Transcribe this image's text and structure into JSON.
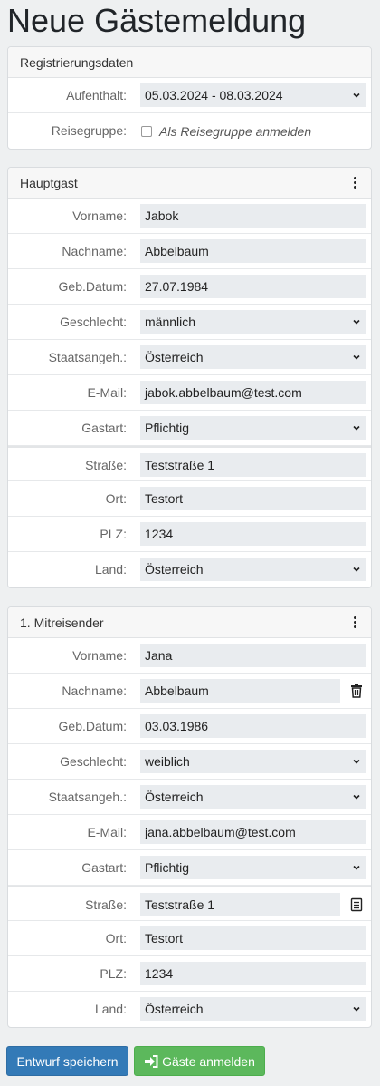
{
  "page": {
    "title": "Neue Gästemeldung"
  },
  "registration": {
    "header": "Registrierungsdaten",
    "stay_label": "Aufenthalt:",
    "stay_value": "05.03.2024 - 08.03.2024",
    "group_label": "Reisegruppe:",
    "group_checkbox_label": "Als Reisegruppe anmelden"
  },
  "main_guest": {
    "header": "Hauptgast",
    "labels": {
      "firstname": "Vorname:",
      "lastname": "Nachname:",
      "birthdate": "Geb.Datum:",
      "gender": "Geschlecht:",
      "nationality": "Staatsangeh.:",
      "email": "E-Mail:",
      "guest_type": "Gastart:",
      "street": "Straße:",
      "city": "Ort:",
      "zip": "PLZ:",
      "country": "Land:"
    },
    "values": {
      "firstname": "Jabok",
      "lastname": "Abbelbaum",
      "birthdate": "27.07.1984",
      "gender": "männlich",
      "nationality": "Österreich",
      "email": "jabok.abbelbaum@test.com",
      "guest_type": "Pflichtig",
      "street": "Teststraße 1",
      "city": "Testort",
      "zip": "1234",
      "country": "Österreich"
    }
  },
  "companion": {
    "header": "1. Mitreisender",
    "labels": {
      "firstname": "Vorname:",
      "lastname": "Nachname:",
      "birthdate": "Geb.Datum:",
      "gender": "Geschlecht:",
      "nationality": "Staatsangeh.:",
      "email": "E-Mail:",
      "guest_type": "Gastart:",
      "street": "Straße:",
      "city": "Ort:",
      "zip": "PLZ:",
      "country": "Land:"
    },
    "values": {
      "firstname": "Jana",
      "lastname": "Abbelbaum",
      "birthdate": "03.03.1986",
      "gender": "weiblich",
      "nationality": "Österreich",
      "email": "jana.abbelbaum@test.com",
      "guest_type": "Pflichtig",
      "street": "Teststraße 1",
      "city": "Testort",
      "zip": "1234",
      "country": "Österreich"
    }
  },
  "icons": {
    "menu": "kebab-menu-icon",
    "delete": "trash-icon",
    "copy_address": "document-icon",
    "select": "chevron-down-icon",
    "submit": "sign-in-icon"
  },
  "actions": {
    "save_draft": "Entwurf speichern",
    "register_guests": "Gäste anmelden"
  },
  "colors": {
    "primary": "#337ab7",
    "success": "#5cb85c",
    "input_bg": "#e9ecef"
  }
}
